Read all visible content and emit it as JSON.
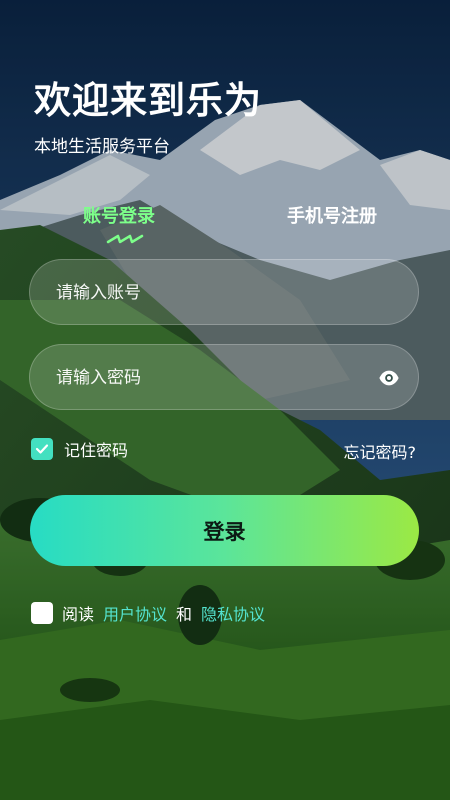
{
  "header": {
    "title": "欢迎来到乐为",
    "subtitle": "本地生活服务平台"
  },
  "tabs": {
    "account": "账号登录",
    "phone": "手机号注册",
    "active": "account"
  },
  "form": {
    "account_placeholder": "请输入账号",
    "account_value": "",
    "password_placeholder": "请输入密码",
    "password_value": "",
    "remember_label": "记住密码",
    "remember_checked": true,
    "forgot_label": "忘记密码?"
  },
  "login_label": "登录",
  "agreement": {
    "prefix": "阅读",
    "user_agreement": "用户协议",
    "conjunction": "和",
    "privacy_policy": "隐私协议",
    "checked": false
  },
  "icons": {
    "password_toggle": "eye-icon",
    "remember_check": "check-icon"
  },
  "colors": {
    "active_tab": "#7dff8a",
    "link": "#54e3cf",
    "checkbox": "#43e0c0",
    "button_gradient_start": "#27dcc4",
    "button_gradient_end": "#9be944"
  }
}
